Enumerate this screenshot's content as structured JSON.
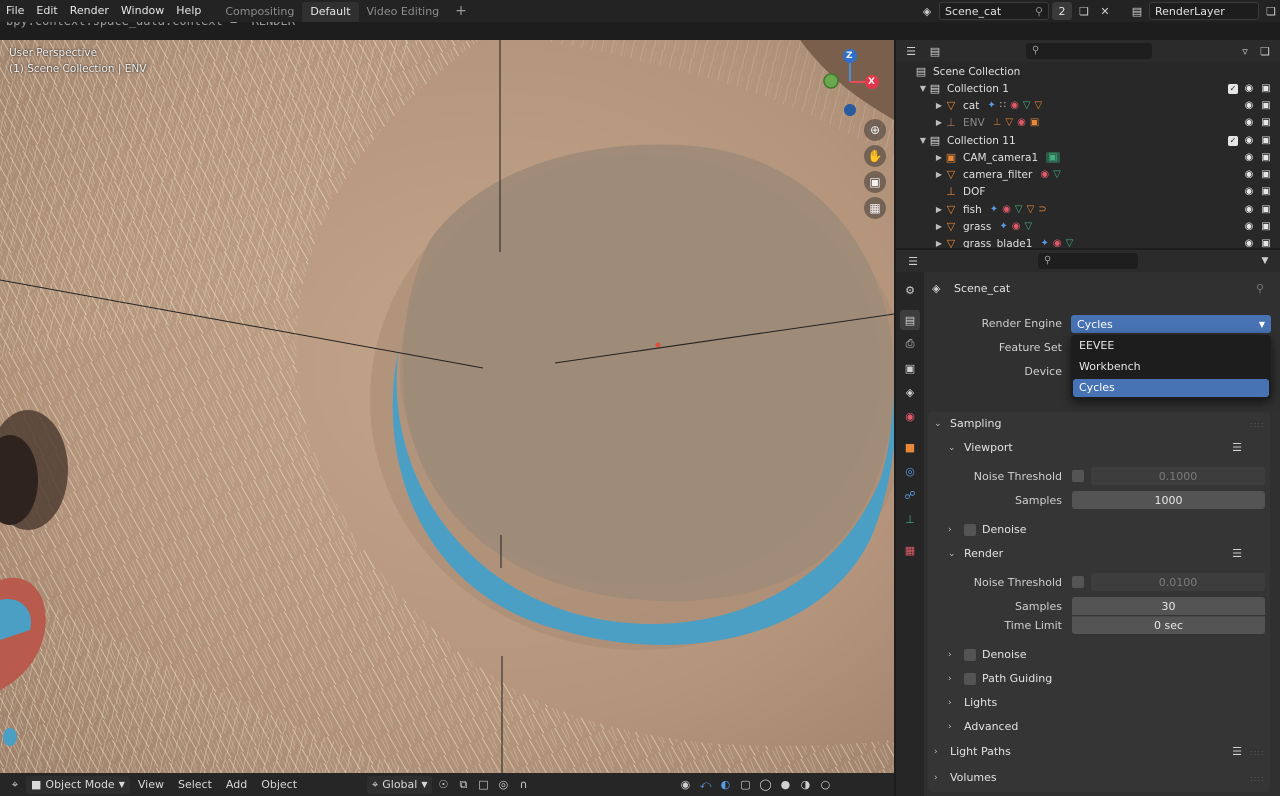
{
  "menu": [
    "File",
    "Edit",
    "Render",
    "Window",
    "Help"
  ],
  "workspaces": [
    {
      "label": "Compositing",
      "active": false
    },
    {
      "label": "Default",
      "active": true
    },
    {
      "label": "Video Editing",
      "active": false
    }
  ],
  "ghost_code": "bpy.context.space_data.context = 'RENDER'",
  "scene": {
    "name": "Scene_cat",
    "users": "2",
    "view_layer": "RenderLayer"
  },
  "viewport": {
    "view_name": "User Perspective",
    "collection_info": "(1) Scene Collection | ENV",
    "gizmo_axes": {
      "z": "Z",
      "x": "X"
    }
  },
  "bottom_bar": {
    "mode": "Object Mode",
    "menus": [
      "View",
      "Select",
      "Add",
      "Object"
    ],
    "transform_orientation": "Global"
  },
  "outliner": {
    "root": "Scene Collection",
    "rows": [
      {
        "label": "Collection 1",
        "kind": "collection",
        "extras": ""
      },
      {
        "label": "cat",
        "kind": "object",
        "extras": "3 5"
      },
      {
        "label": "ENV",
        "kind": "object-dim",
        "extras": "10 2"
      },
      {
        "label": "Collection 11",
        "kind": "collection",
        "extras": ""
      },
      {
        "label": "CAM_camera1",
        "kind": "object",
        "extras": ""
      },
      {
        "label": "camera_filter",
        "kind": "object",
        "extras": ""
      },
      {
        "label": "DOF",
        "kind": "empty",
        "extras": ""
      },
      {
        "label": "fish",
        "kind": "object",
        "extras": "4"
      },
      {
        "label": "grass",
        "kind": "object",
        "extras": ""
      },
      {
        "label": "grass_blade1",
        "kind": "object",
        "extras": ""
      }
    ]
  },
  "properties": {
    "scene_name": "Scene_cat",
    "render_engine_label": "Render Engine",
    "render_engine_value": "Cycles",
    "feature_set_label": "Feature Set",
    "device_label": "Device",
    "engine_options": [
      "EEVEE",
      "Workbench",
      "Cycles"
    ],
    "sampling": {
      "title": "Sampling",
      "viewport": {
        "title": "Viewport",
        "noise_threshold_label": "Noise Threshold",
        "noise_threshold": "0.1000",
        "samples_label": "Samples",
        "samples": "1000",
        "denoise_label": "Denoise"
      },
      "render": {
        "title": "Render",
        "noise_threshold_label": "Noise Threshold",
        "noise_threshold": "0.0100",
        "samples_label": "Samples",
        "samples": "30",
        "time_limit_label": "Time Limit",
        "time_limit": "0 sec",
        "denoise_label": "Denoise"
      },
      "path_guiding": "Path Guiding",
      "lights": "Lights",
      "advanced": "Advanced"
    },
    "light_paths": "Light Paths",
    "volumes": "Volumes"
  },
  "colors": {
    "accent_blue": "#4772b3",
    "panel_bg": "#303030",
    "object_orange": "#e8883a",
    "mesh_green": "#40b080"
  }
}
